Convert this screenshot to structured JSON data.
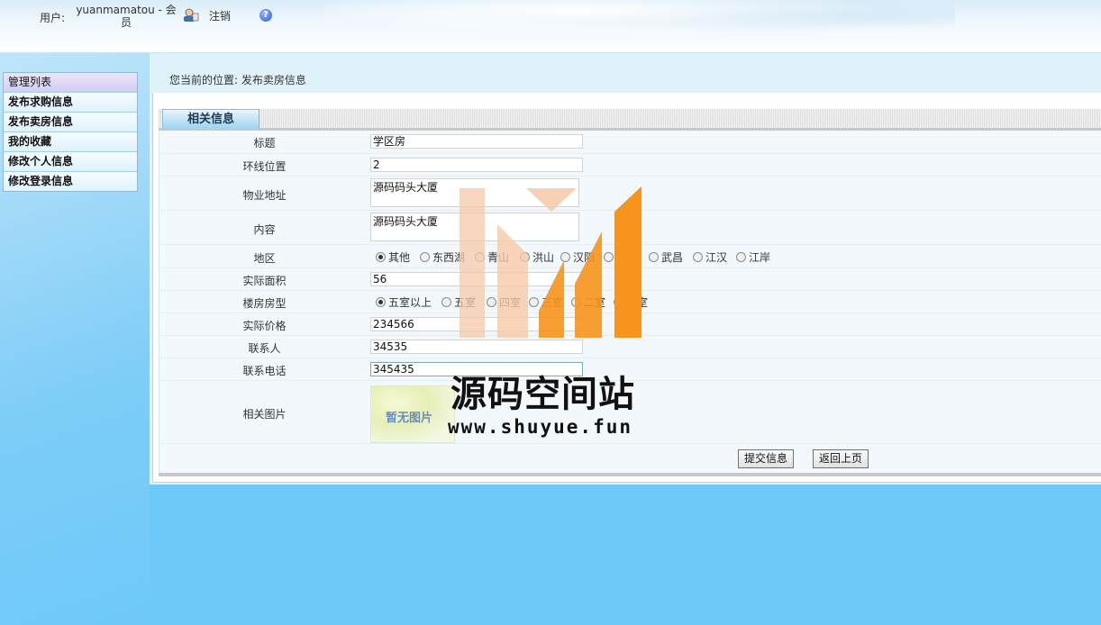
{
  "header": {
    "user_label": "用户:",
    "user_name": "yuanmamatou - 会员",
    "logout_label": "注销",
    "help_glyph": "?"
  },
  "sidebar": {
    "items": [
      {
        "label": "管理列表"
      },
      {
        "label": "发布求购信息"
      },
      {
        "label": "发布卖房信息"
      },
      {
        "label": "我的收藏"
      },
      {
        "label": "修改个人信息"
      },
      {
        "label": "修改登录信息"
      }
    ]
  },
  "breadcrumb": "您当前的位置: 发布卖房信息",
  "tab_label": "相关信息",
  "form": {
    "title": {
      "label": "标题",
      "value": "学区房"
    },
    "ring": {
      "label": "环线位置",
      "value": "2"
    },
    "address": {
      "label": "物业地址",
      "value": "源码码头大厦"
    },
    "content": {
      "label": "内容",
      "value": "源码码头大厦"
    },
    "region": {
      "label": "地区",
      "options": [
        "其他",
        "东西湖",
        "青山",
        "洪山",
        "汉阳",
        "硚口",
        "武昌",
        "江汉",
        "江岸"
      ],
      "selected": "其他"
    },
    "area": {
      "label": "实际面积",
      "value": "56"
    },
    "layout": {
      "label": "楼房房型",
      "options": [
        "五室以上",
        "五室",
        "四室",
        "三室",
        "二室",
        "一室"
      ],
      "selected": "五室以上"
    },
    "price": {
      "label": "实际价格",
      "value": "234566"
    },
    "contact": {
      "label": "联系人",
      "value": "34535"
    },
    "phone": {
      "label": "联系电话",
      "value": "345435"
    },
    "photo": {
      "label": "相关图片",
      "placeholder_text": "暂无图片"
    }
  },
  "buttons": {
    "submit": "提交信息",
    "back": "返回上页"
  },
  "watermark": {
    "title": "源码空间站",
    "url": "www.shuyue.fun"
  },
  "colors": {
    "page_bg": "#6ec9f8",
    "logo_orange": "#f7941d",
    "logo_light": "#f6c9a8"
  },
  "icons": {
    "user": "user-icon",
    "help": "help-icon"
  }
}
